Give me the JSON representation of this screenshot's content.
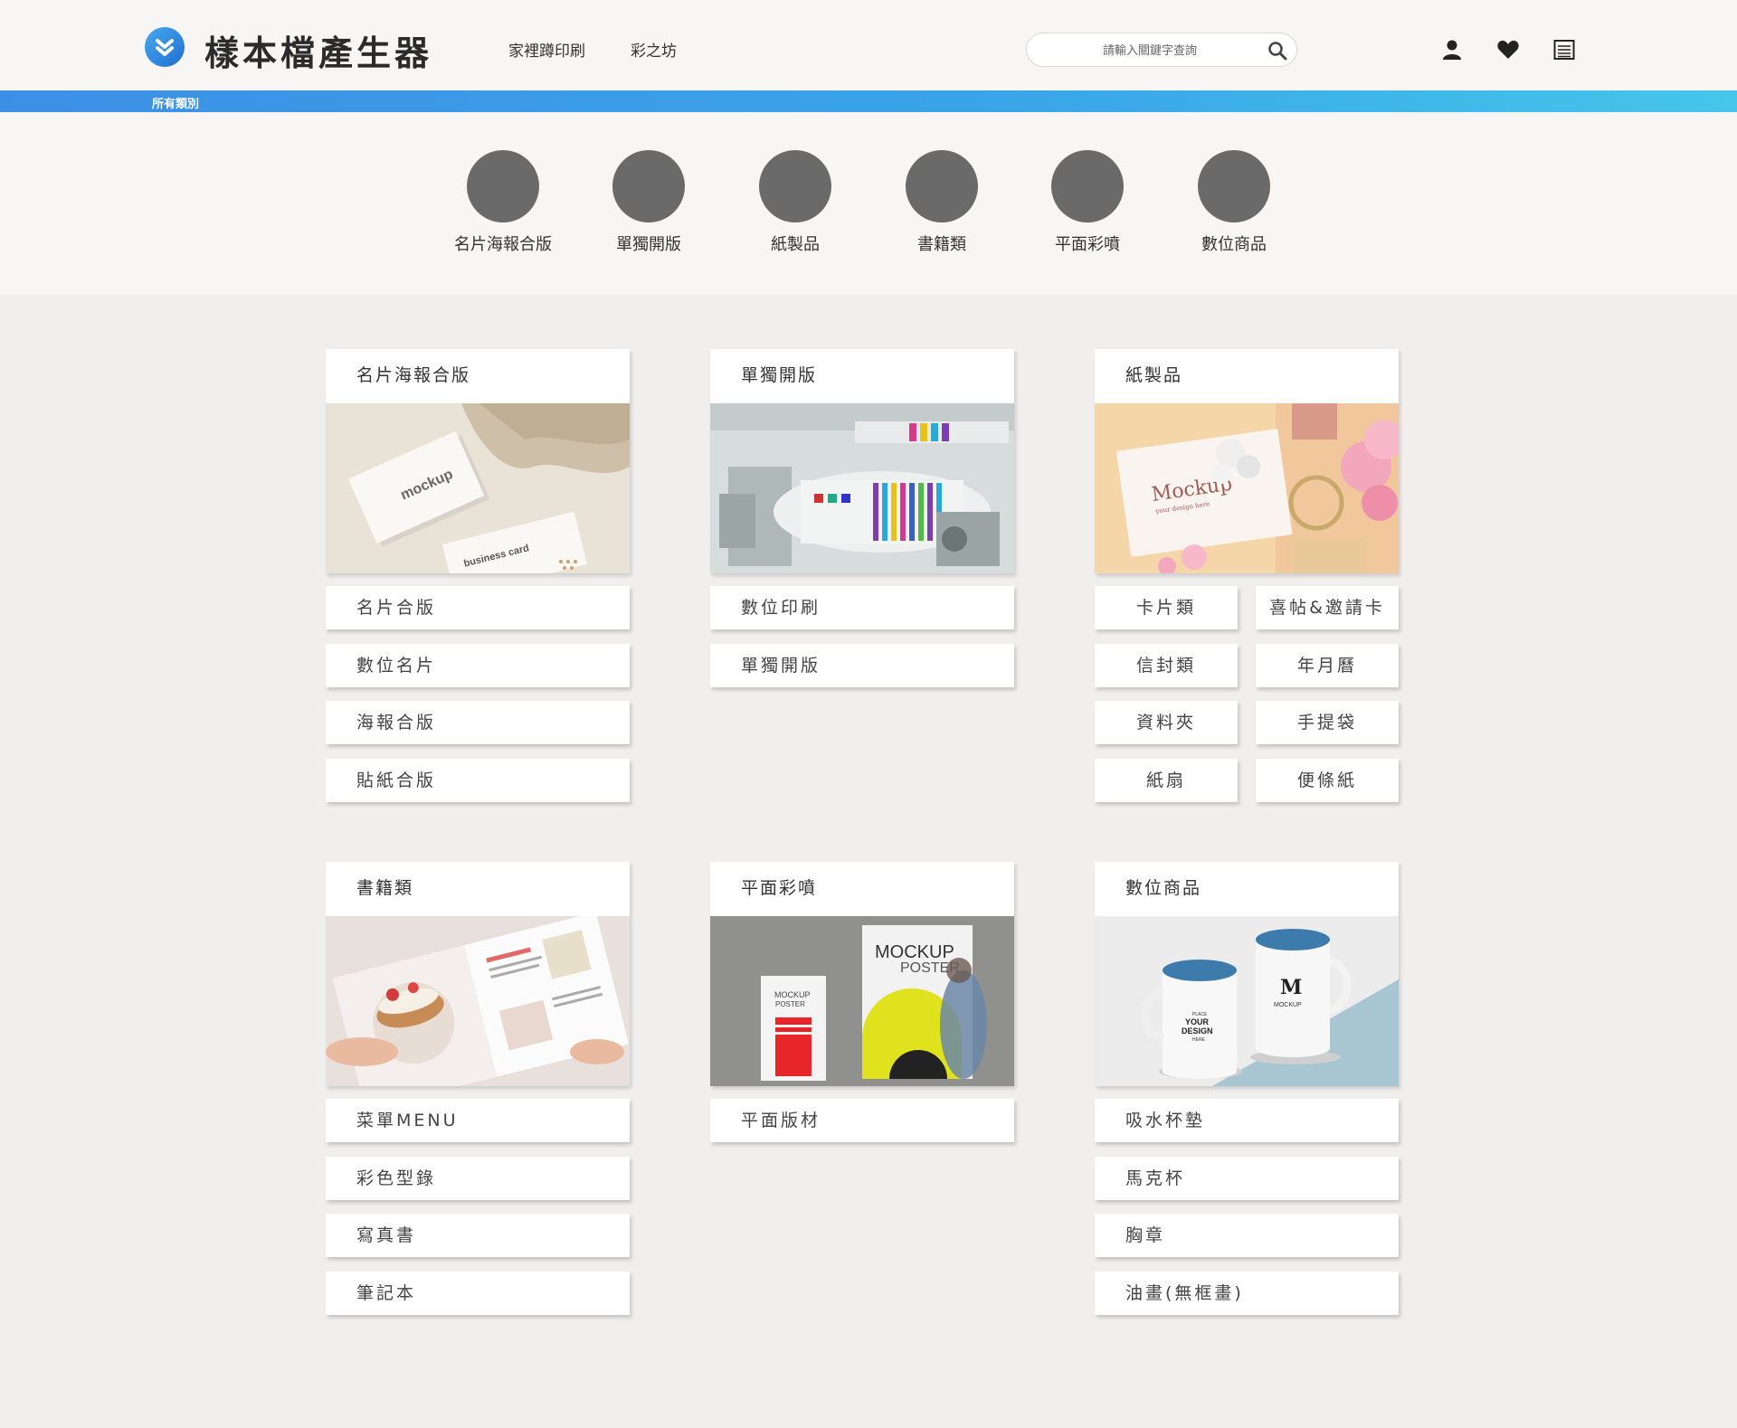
{
  "header": {
    "site_title": "樣本檔產生器",
    "nav": [
      "家裡蹲印刷",
      "彩之坊"
    ],
    "search_placeholder": "請輸入關鍵字查詢",
    "icons": [
      "user-icon",
      "heart-icon",
      "list-icon"
    ]
  },
  "category_bar": {
    "label": "所有類別"
  },
  "circle_categories": [
    "名片海報合版",
    "單獨開版",
    "紙製品",
    "書籍類",
    "平面彩噴",
    "數位商品"
  ],
  "cards": {
    "c1": {
      "title": "名片海報合版",
      "items": [
        "名片合版",
        "數位名片",
        "海報合版",
        "貼紙合版"
      ]
    },
    "c2": {
      "title": "單獨開版",
      "items": [
        "數位印刷",
        "單獨開版"
      ]
    },
    "c3": {
      "title": "紙製品",
      "items": [
        "卡片類",
        "喜帖&邀請卡",
        "信封類",
        "年月曆",
        "資料夾",
        "手提袋",
        "紙扇",
        "便條紙"
      ]
    },
    "c4": {
      "title": "書籍類",
      "items": [
        "菜單MENU",
        "彩色型錄",
        "寫真書",
        "筆記本"
      ]
    },
    "c5": {
      "title": "平面彩噴",
      "items": [
        "平面版材"
      ]
    },
    "c6": {
      "title": "數位商品",
      "items": [
        "吸水杯墊",
        "馬克杯",
        "胸章",
        "油畫(無框畫)"
      ]
    }
  },
  "image_text": {
    "mockup": "mockup",
    "business_card": "business card",
    "mockup_script": "Mockup",
    "mockup_script_sub": "your design here",
    "mockup_poster_big": "MOCKUP",
    "poster_word": "POSTER",
    "mockup_poster_small": "MOCKUP",
    "poster_small": "POSTER",
    "mug_place": "PLACE",
    "mug_your": "YOUR",
    "mug_design": "DESIGN",
    "mug_here": "HERE",
    "mug_logo": "M",
    "mug_mockup": "MOCKUP"
  },
  "colors": {
    "accent_start": "#3d8fe6",
    "accent_end": "#45c6ea",
    "circle": "#6a6a6a"
  }
}
